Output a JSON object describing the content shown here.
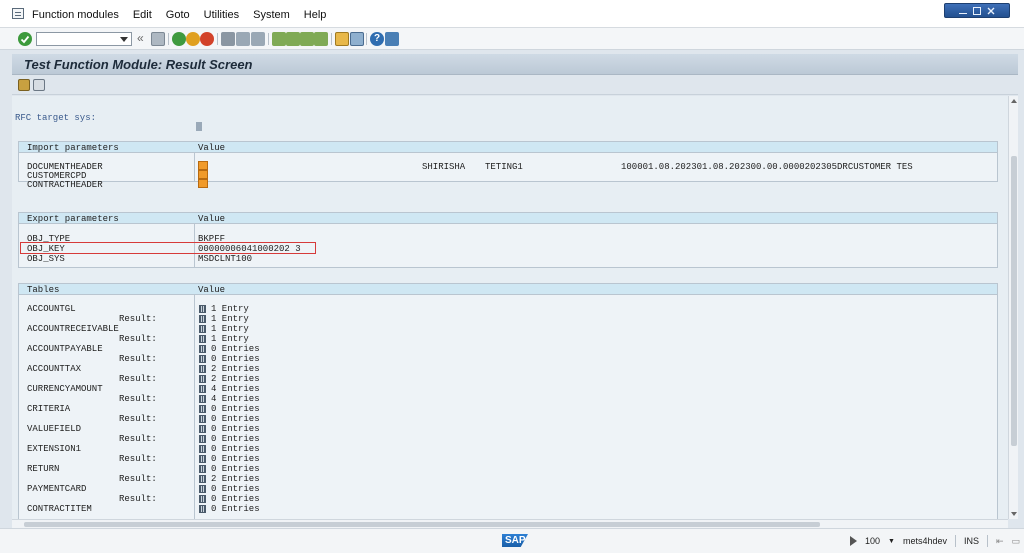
{
  "menu": {
    "items": [
      "Function modules",
      "Edit",
      "Goto",
      "Utilities",
      "System",
      "Help"
    ]
  },
  "toolbar": {
    "command_value": "",
    "icons": [
      "enter-icon",
      "back-icon",
      "save-icon",
      "back-green-icon",
      "exit-icon",
      "cancel-icon",
      "print-icon",
      "find-icon",
      "find-next-icon",
      "first-page-icon",
      "prev-page-icon",
      "next-page-icon",
      "last-page-icon",
      "new-session-icon",
      "shortcut-icon",
      "help-icon",
      "customize-icon"
    ]
  },
  "title": "Test Function Module: Result Screen",
  "rfc": {
    "label": "RFC target sys:"
  },
  "import": {
    "header": "Import parameters",
    "value_header": "Value",
    "rows": [
      "DOCUMENTHEADER",
      "CUSTOMERCPD",
      "CONTRACTHEADER"
    ],
    "doc_values": [
      "SHIRISHA",
      "TETING1",
      "100001.08.202301.08.202300.00.0000202305DRCUSTOMER TES"
    ]
  },
  "export": {
    "header": "Export parameters",
    "value_header": "Value",
    "rows": [
      {
        "name": "OBJ_TYPE",
        "value": "BKPFF"
      },
      {
        "name": "OBJ_KEY",
        "value": "00000006041000202 3"
      },
      {
        "name": "OBJ_SYS",
        "value": "MSDCLNT100"
      }
    ]
  },
  "tables": {
    "header": "Tables",
    "value_header": "Value",
    "result_label": "Result:",
    "rows": [
      {
        "name": "ACCOUNTGL",
        "input": "1 Entry",
        "result": "1 Entry"
      },
      {
        "name": "ACCOUNTRECEIVABLE",
        "input": "1 Entry",
        "result": "1 Entry"
      },
      {
        "name": "ACCOUNTPAYABLE",
        "input": "0 Entries",
        "result": "0 Entries"
      },
      {
        "name": "ACCOUNTTAX",
        "input": "2 Entries",
        "result": "2 Entries"
      },
      {
        "name": "CURRENCYAMOUNT",
        "input": "4 Entries",
        "result": "4 Entries"
      },
      {
        "name": "CRITERIA",
        "input": "0 Entries",
        "result": "0 Entries"
      },
      {
        "name": "VALUEFIELD",
        "input": "0 Entries",
        "result": "0 Entries"
      },
      {
        "name": "EXTENSION1",
        "input": "0 Entries",
        "result": "0 Entries"
      },
      {
        "name": "RETURN",
        "input": "0 Entries",
        "result": "2 Entries"
      },
      {
        "name": "PAYMENTCARD",
        "input": "0 Entries",
        "result": "0 Entries"
      },
      {
        "name": "CONTRACTITEM",
        "input": "0 Entries",
        "result": ""
      }
    ]
  },
  "status": {
    "logo": "SAP",
    "client": "100",
    "server": "mets4hdev",
    "mode": "INS"
  },
  "colors": {
    "highlight": "#d63a3a",
    "section_header": "#cfe7f3",
    "title_bar": "#c5d2de"
  }
}
